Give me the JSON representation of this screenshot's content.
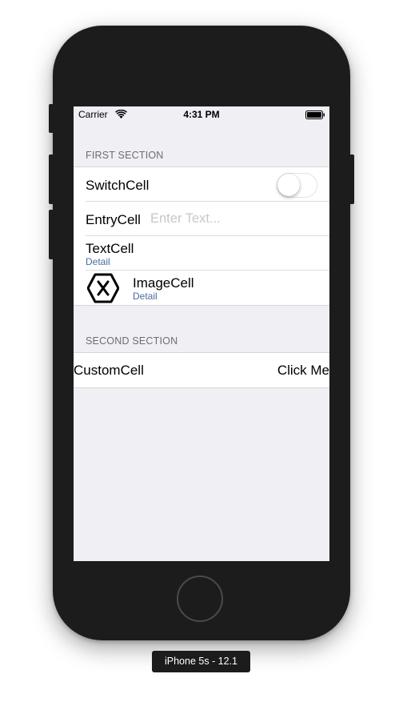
{
  "status_bar": {
    "carrier": "Carrier",
    "time": "4:31 PM"
  },
  "sections": [
    {
      "header": "FIRST SECTION",
      "cells": [
        {
          "type": "switch",
          "label": "SwitchCell",
          "switch_on": false
        },
        {
          "type": "entry",
          "label": "EntryCell",
          "placeholder": "Enter Text...",
          "value": ""
        },
        {
          "type": "text",
          "label": "TextCell",
          "detail": "Detail"
        },
        {
          "type": "image",
          "label": "ImageCell",
          "detail": "Detail",
          "icon": "xamarin-logo-icon"
        }
      ]
    },
    {
      "header": "SECOND SECTION",
      "cells": [
        {
          "type": "custom",
          "label": "CustomCell",
          "button_label": "Click Me"
        }
      ]
    }
  ],
  "device_label": "iPhone 5s - 12.1",
  "colors": {
    "detail": "#4a6da0",
    "table_background": "#efeff4",
    "section_header": "#6d6d72"
  }
}
